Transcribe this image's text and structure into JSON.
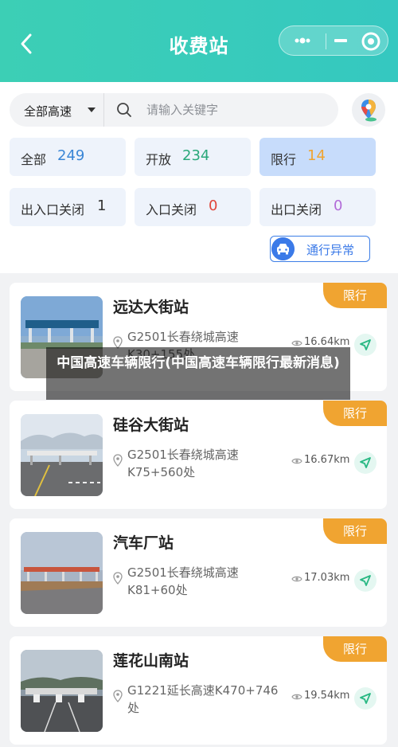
{
  "header": {
    "title": "收费站"
  },
  "search": {
    "scope": "全部高速",
    "placeholder": "请输入关键字"
  },
  "stats": [
    {
      "label": "全部",
      "count": "249",
      "color": "#3a86d6"
    },
    {
      "label": "开放",
      "count": "234",
      "color": "#2aa87a"
    },
    {
      "label": "限行",
      "count": "14",
      "color": "#f0a431"
    },
    {
      "label": "出入口关闭",
      "count": "1",
      "color": "#333333"
    },
    {
      "label": "入口关闭",
      "count": "0",
      "color": "#e0453a"
    },
    {
      "label": "出口关闭",
      "count": "0",
      "color": "#b26bd8"
    }
  ],
  "abnormal_button": {
    "label": "通行异常"
  },
  "stations": [
    {
      "name": "远达大街站",
      "badge": "限行",
      "address": "G2501长春绕城高速K30+155处",
      "distance": "16.64km"
    },
    {
      "name": "硅谷大街站",
      "badge": "限行",
      "address": "G2501长春绕城高速K75+560处",
      "distance": "16.67km"
    },
    {
      "name": "汽车厂站",
      "badge": "限行",
      "address": "G2501长春绕城高速K81+60处",
      "distance": "17.03km"
    },
    {
      "name": "莲花山南站",
      "badge": "限行",
      "address": "G1221延长高速K470+746处",
      "distance": "19.54km"
    }
  ],
  "overlay": {
    "caption": "中国高速车辆限行(中国高速车辆限行最新消息)"
  },
  "colors": {
    "header": "#3ccfb5",
    "badge": "#f0a431",
    "accent_blue": "#3b7ae8"
  }
}
